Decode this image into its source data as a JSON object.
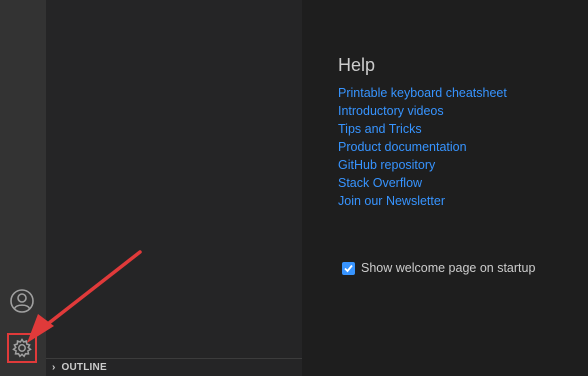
{
  "sidebar": {
    "outline_label": "OUTLINE"
  },
  "activity_bar": {
    "icons": [
      "account-icon",
      "gear-icon"
    ]
  },
  "welcome": {
    "help_title": "Help",
    "help_links": [
      "Printable keyboard cheatsheet",
      "Introductory videos",
      "Tips and Tricks",
      "Product documentation",
      "GitHub repository",
      "Stack Overflow",
      "Join our Newsletter"
    ],
    "startup_label": "Show welcome page on startup",
    "startup_checked": true
  },
  "annotation": {
    "arrow_color": "#e03a3a"
  },
  "colors": {
    "link": "#3794ff",
    "text": "#cccccc",
    "activity_bar_bg": "#333333",
    "sidebar_bg": "#252526",
    "editor_bg": "#1e1e1e"
  }
}
